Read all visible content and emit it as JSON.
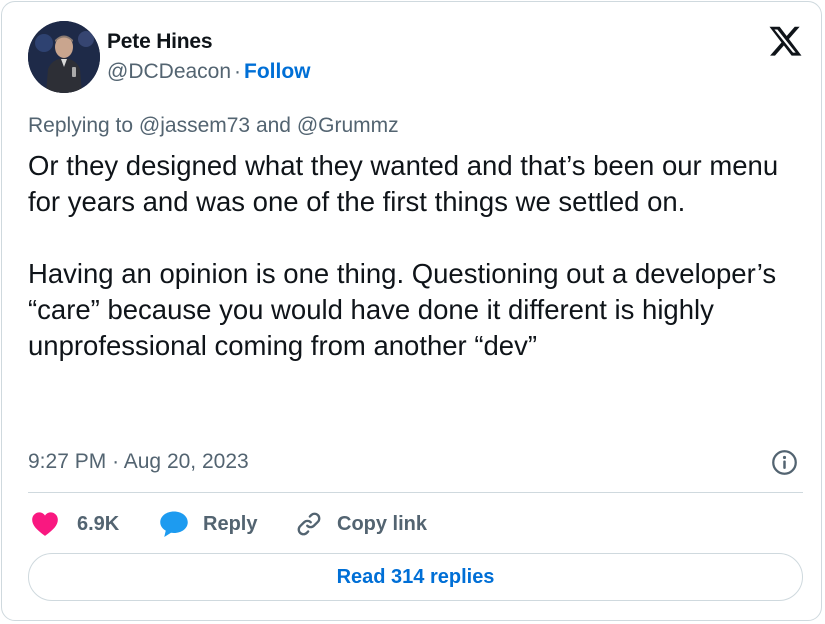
{
  "author": {
    "name": "Pete Hines",
    "handle": "@DCDeacon",
    "separator": "·",
    "follow_label": "Follow"
  },
  "reply_context": {
    "prefix": "Replying to",
    "mention_1": "@jassem73",
    "conjunction": "and",
    "mention_2": "@Grummz"
  },
  "tweet": {
    "paragraph_1": "Or they designed what they wanted and that’s been our menu for years and was one of the first things we settled on.",
    "paragraph_2": "Having an opinion is one thing. Questioning out a developer’s “care” because you would have done it different is highly unprofessional coming from another “dev”"
  },
  "timestamp": {
    "time": "9:27 PM",
    "separator": "·",
    "date": "Aug 20, 2023"
  },
  "actions": {
    "like_count": "6.9K",
    "reply_label": "Reply",
    "copy_link_label": "Copy link"
  },
  "read_replies_label": "Read 314 replies",
  "colors": {
    "accent": "#006fd6",
    "like": "#f91880",
    "reply_icon": "#1d9bf0",
    "secondary_text": "#536471",
    "border": "#cfd9de"
  },
  "icons": {
    "platform": "x-logo-icon",
    "info": "info-icon",
    "like": "heart-icon",
    "reply": "speech-bubble-icon",
    "copy_link": "link-icon"
  }
}
